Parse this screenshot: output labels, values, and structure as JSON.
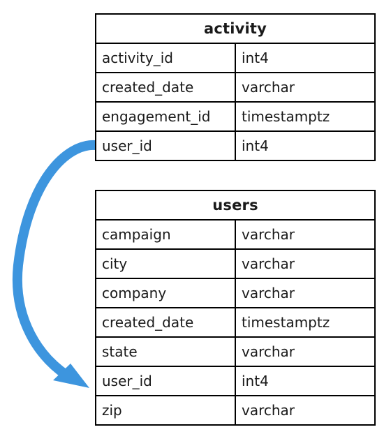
{
  "diagram": {
    "type": "entity-relationship-diagram",
    "background_color": "#ffffff",
    "border_color": "#000000",
    "text_color": "#1a1a1a",
    "tables": [
      {
        "name": "activity",
        "columns": [
          {
            "name": "activity_id",
            "type": "int4"
          },
          {
            "name": "created_date",
            "type": "varchar"
          },
          {
            "name": "engagement_id",
            "type": "timestamptz"
          },
          {
            "name": "user_id",
            "type": "int4"
          }
        ]
      },
      {
        "name": "users",
        "columns": [
          {
            "name": "campaign",
            "type": "varchar"
          },
          {
            "name": "city",
            "type": "varchar"
          },
          {
            "name": "company",
            "type": "varchar"
          },
          {
            "name": "created_date",
            "type": "timestamptz"
          },
          {
            "name": "state",
            "type": "varchar"
          },
          {
            "name": "user_id",
            "type": "int4"
          },
          {
            "name": "zip",
            "type": "varchar"
          }
        ]
      }
    ],
    "relationship": {
      "name": "activity-user_id-to-users-user_id",
      "from_table": "activity",
      "from_column": "user_id",
      "to_table": "users",
      "to_column": "user_id",
      "color": "#3d95de",
      "style": "curved-arrow"
    }
  }
}
